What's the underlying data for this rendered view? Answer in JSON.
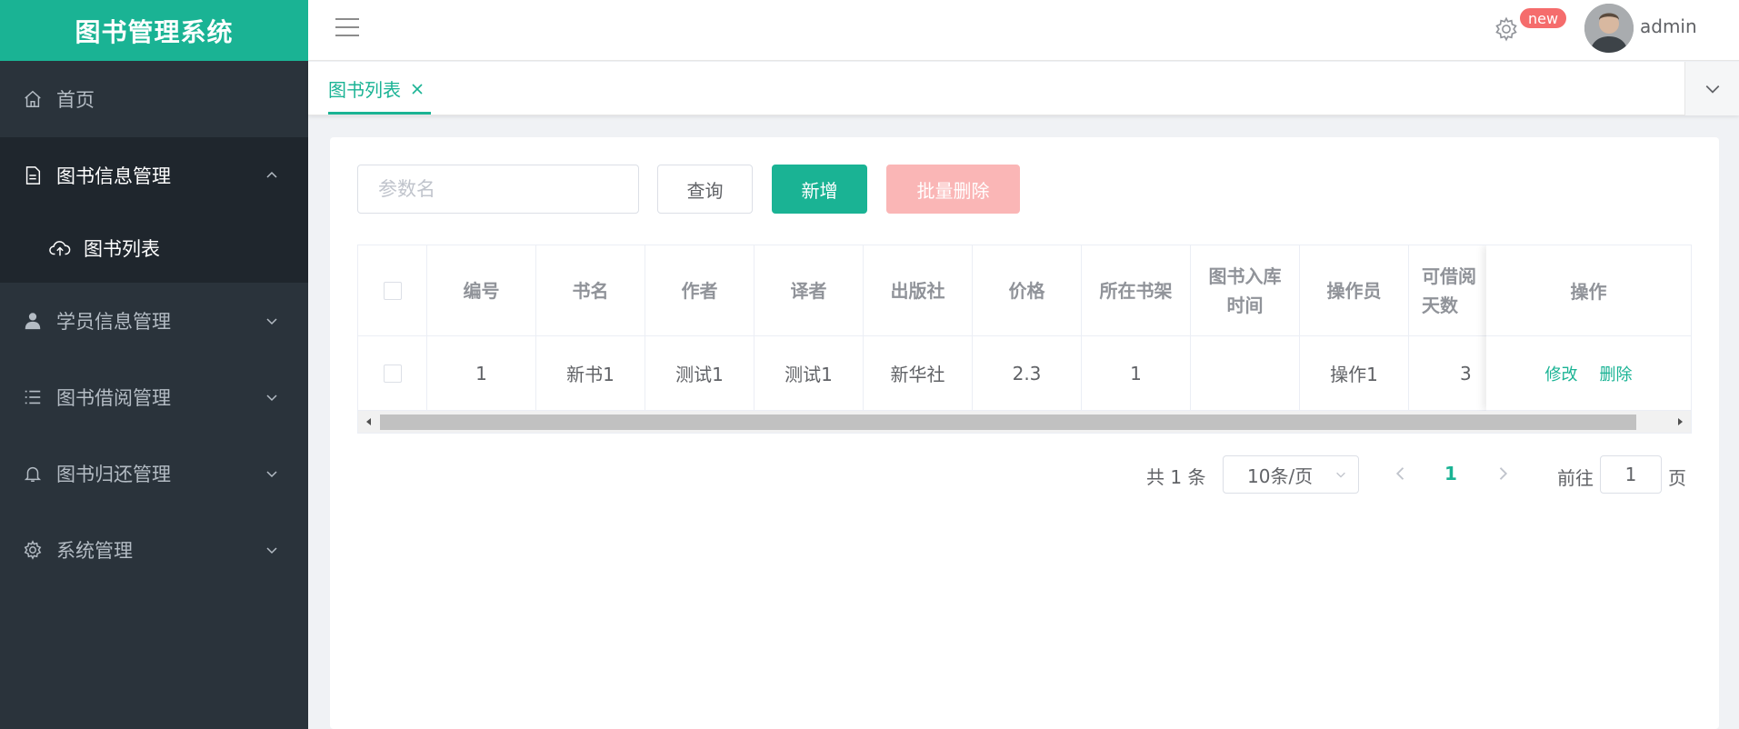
{
  "app": {
    "title": "图书管理系统"
  },
  "sidebar": {
    "items": [
      {
        "label": "首页",
        "icon": "home-icon"
      },
      {
        "label": "图书信息管理",
        "icon": "document-icon",
        "open": true,
        "children": [
          {
            "label": "图书列表",
            "icon": "upload-cloud-icon"
          }
        ]
      },
      {
        "label": "学员信息管理",
        "icon": "user-icon"
      },
      {
        "label": "图书借阅管理",
        "icon": "list-icon"
      },
      {
        "label": "图书归还管理",
        "icon": "bell-icon"
      },
      {
        "label": "系统管理",
        "icon": "gear-icon"
      }
    ]
  },
  "header": {
    "badge": "new",
    "username": "admin"
  },
  "tabs": [
    {
      "label": "图书列表",
      "active": true
    }
  ],
  "toolbar": {
    "search_placeholder": "参数名",
    "search_value": "",
    "query_label": "查询",
    "add_label": "新增",
    "batch_delete_label": "批量删除"
  },
  "table": {
    "columns": [
      "编号",
      "书名",
      "作者",
      "译者",
      "出版社",
      "价格",
      "所在书架",
      "图书入库时间",
      "操作员",
      "可借阅天数"
    ],
    "action_header": "操作",
    "rows": [
      {
        "cells": [
          "1",
          "新书1",
          "测试1",
          "测试1",
          "新华社",
          "2.3",
          "1",
          "",
          "操作1",
          "3"
        ],
        "actions": {
          "edit": "修改",
          "delete": "删除"
        }
      }
    ]
  },
  "pagination": {
    "total_text": "共 1 条",
    "page_size": "10条/页",
    "current_page": "1",
    "goto_label": "前往",
    "goto_value": "1",
    "page_suffix": "页"
  },
  "colors": {
    "accent": "#1ab394",
    "sidebar_bg": "#2a333b",
    "danger_light": "#fab6b6"
  }
}
